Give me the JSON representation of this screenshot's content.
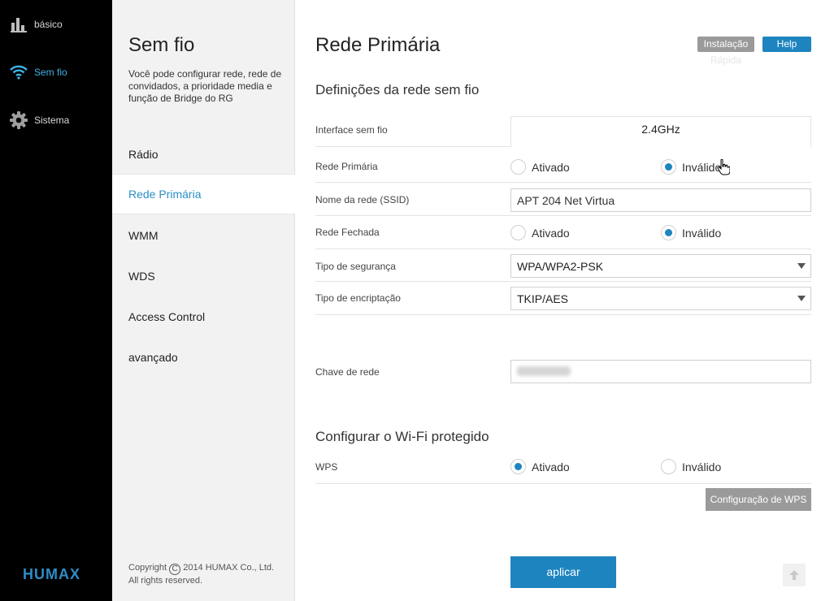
{
  "nav": {
    "items": [
      {
        "label": "básico",
        "icon": "bar-chart-icon",
        "active": false
      },
      {
        "label": "Sem fio",
        "icon": "wifi-icon",
        "active": true
      },
      {
        "label": "Sistema",
        "icon": "gear-icon",
        "active": false
      }
    ],
    "logo": "HUMAX",
    "accent": "#3db2e6"
  },
  "sub": {
    "title": "Sem fio",
    "description": "Você pode configurar rede, rede de convidados, a prioridade media e função de Bridge do RG",
    "items": [
      {
        "label": "Rádio"
      },
      {
        "label": "Rede Primária"
      },
      {
        "label": "WMM"
      },
      {
        "label": "WDS"
      },
      {
        "label": "Access Control"
      },
      {
        "label": "avançado"
      }
    ],
    "active_index": 1,
    "copyright_prefix": "Copyright",
    "copyright_symbol": "C",
    "copyright_rest": "2014 HUMAX Co., Ltd.",
    "rights": "All rights reserved."
  },
  "header": {
    "title": "Rede Primária",
    "install_label": "Instalação",
    "install_ghost": "Rápida",
    "help_label": "Help"
  },
  "wireless": {
    "section_title": "Definições da rede sem fio",
    "interface_label": "Interface sem fio",
    "interface_value": "2.4GHz",
    "primary_label": "Rede Primária",
    "primary_on": "Ativado",
    "primary_off": "Inválido",
    "primary_selected": "off",
    "ssid_label": "Nome da rede (SSID)",
    "ssid_value": "APT 204 Net Virtua",
    "closed_label": "Rede Fechada",
    "closed_on": "Ativado",
    "closed_off": "Inválido",
    "closed_selected": "off",
    "security_label": "Tipo de segurança",
    "security_value": "WPA/WPA2-PSK",
    "encryption_label": "Tipo de encriptação",
    "encryption_value": "TKIP/AES",
    "key_label": "Chave de rede"
  },
  "wps": {
    "section_title": "Configurar o Wi-Fi protegido",
    "label": "WPS",
    "on": "Ativado",
    "off": "Inválido",
    "selected": "on",
    "config_button": "Configuração de WPS"
  },
  "apply_label": "aplicar",
  "colors": {
    "primary": "#1e84bf",
    "nav_bg": "#000000",
    "panel_bg": "#f2f2f2",
    "gray_button": "#9a9a9a"
  }
}
